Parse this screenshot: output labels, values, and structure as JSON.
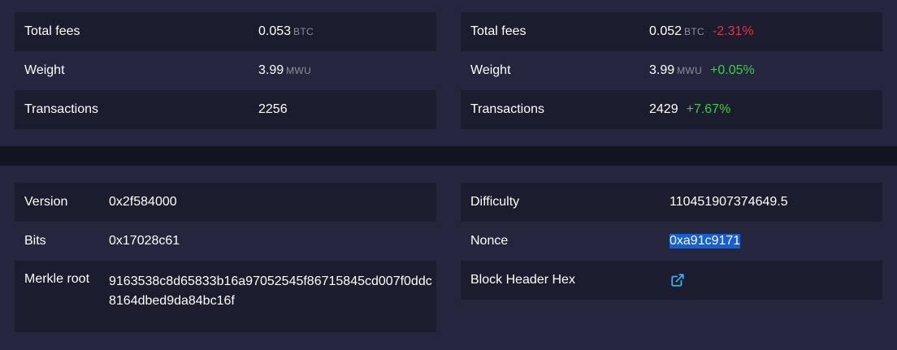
{
  "comparison": {
    "left": {
      "fees_label": "Total fees",
      "fees_value": "0.053",
      "fees_unit": "BTC",
      "weight_label": "Weight",
      "weight_value": "3.99",
      "weight_unit": "MWU",
      "tx_label": "Transactions",
      "tx_value": "2256"
    },
    "right": {
      "fees_label": "Total fees",
      "fees_value": "0.052",
      "fees_unit": "BTC",
      "fees_change": "-2.31%",
      "weight_label": "Weight",
      "weight_value": "3.99",
      "weight_unit": "MWU",
      "weight_change": "+0.05%",
      "tx_label": "Transactions",
      "tx_value": "2429",
      "tx_change": "+7.67%"
    }
  },
  "details": {
    "left": {
      "version_label": "Version",
      "version_value": "0x2f584000",
      "bits_label": "Bits",
      "bits_value": "0x17028c61",
      "merkle_label": "Merkle root",
      "merkle_value": "9163538c8d65833b16a97052545f86715845cd007f0ddc8164dbed9da84bc16f"
    },
    "right": {
      "difficulty_label": "Difficulty",
      "difficulty_value": "110451907374649.5",
      "nonce_label": "Nonce",
      "nonce_value": "0xa91c9171",
      "header_label": "Block Header Hex",
      "header_icon": "external-link-icon"
    }
  },
  "colors": {
    "negative": "#dc3545",
    "positive": "#3bcc49",
    "link": "#2eb5f0",
    "selection": "#1160d9"
  }
}
